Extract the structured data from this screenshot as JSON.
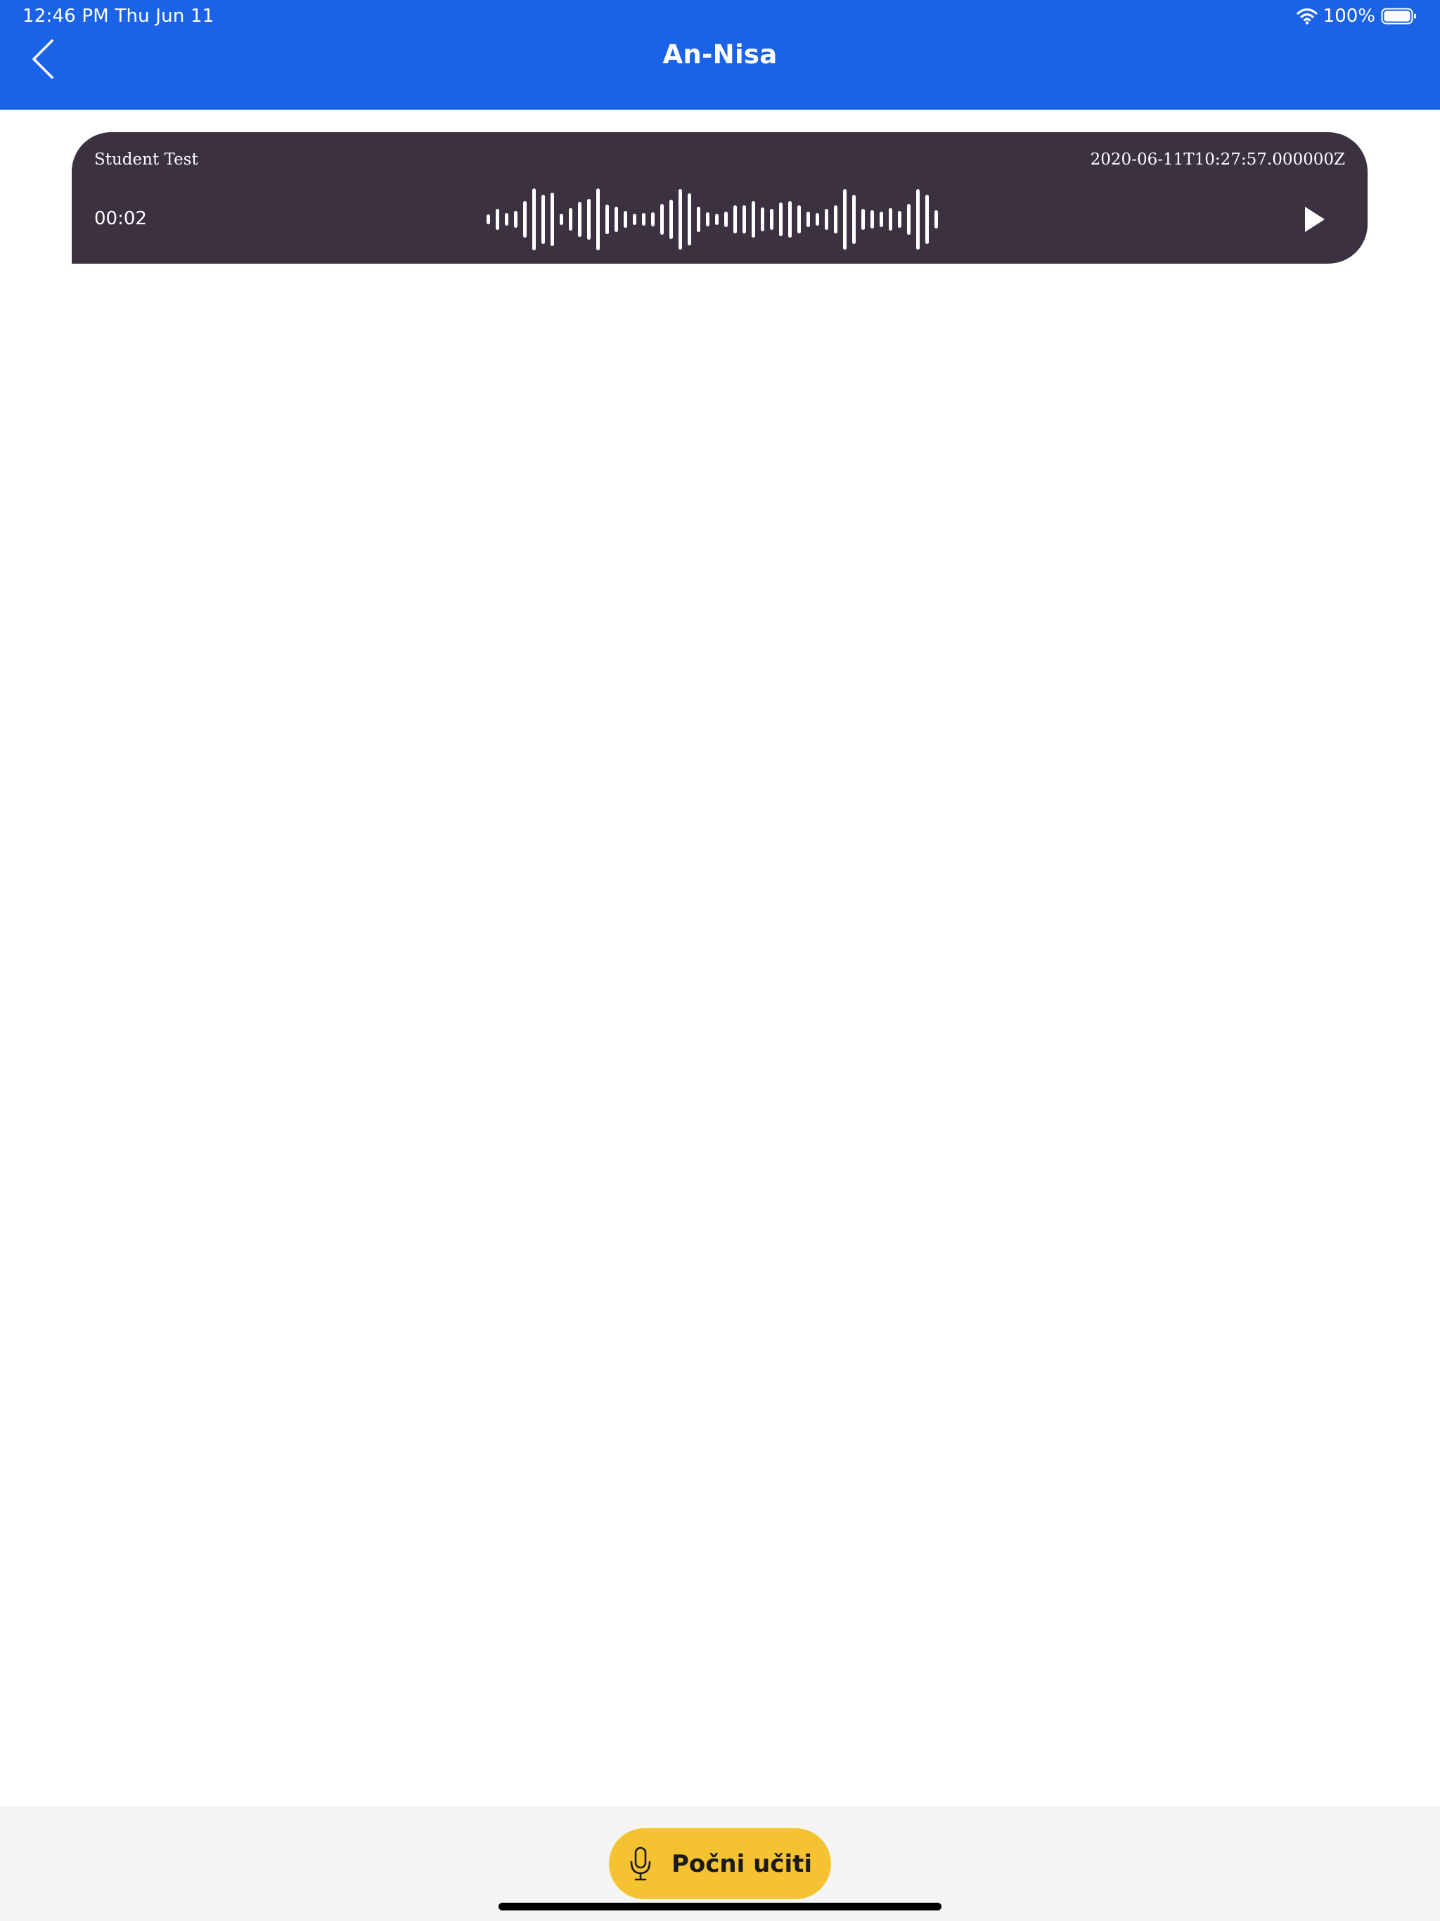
{
  "status_bar": {
    "time": "12:46 PM   Thu Jun 11",
    "battery": "100%",
    "wifi_icon": "wifi-icon",
    "battery_icon": "battery-icon"
  },
  "header": {
    "title": "An-Nisa",
    "back_icon": "chevron-left-icon",
    "background": "#1b63e6"
  },
  "recording": {
    "name": "Student Test",
    "date": "2020-06-11T10:27:57.000000Z",
    "duration": "00:02",
    "play_icon": "play-icon",
    "card_color": "#3b3141"
  },
  "bottom": {
    "record_label": "Počni učiti",
    "mic_icon": "microphone-icon",
    "button_color": "#f5c332"
  }
}
